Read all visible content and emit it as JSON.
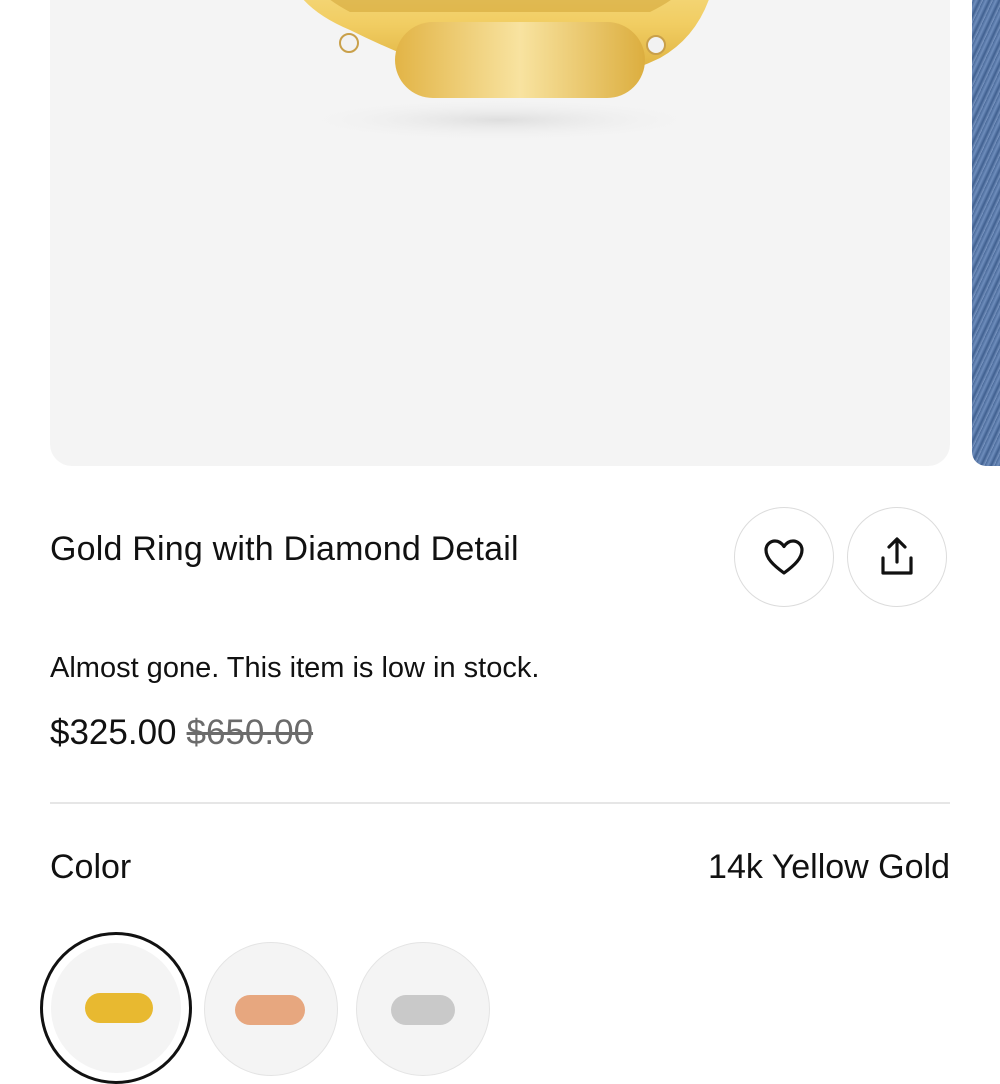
{
  "product": {
    "title": "Gold Ring with Diamond Detail",
    "stock_message": "Almost gone. This item is low in stock.",
    "price_current": "$325.00",
    "price_original": "$650.00"
  },
  "actions": {
    "favorite_icon": "heart-icon",
    "share_icon": "share-icon"
  },
  "color_selector": {
    "label": "Color",
    "selected_value": "14k Yellow Gold",
    "options": [
      {
        "name": "14k Yellow Gold",
        "color": "#e8b930",
        "selected": true
      },
      {
        "name": "rose",
        "color": "#e7a77f",
        "selected": false
      },
      {
        "name": "white",
        "color": "#c9c9c9",
        "selected": false
      }
    ]
  },
  "colors": {
    "background": "#ffffff",
    "image_background": "#f4f4f4",
    "text": "#111111",
    "muted_text": "#6b6b6b",
    "divider": "#e6e6e6",
    "gold": "#e8c14a"
  }
}
